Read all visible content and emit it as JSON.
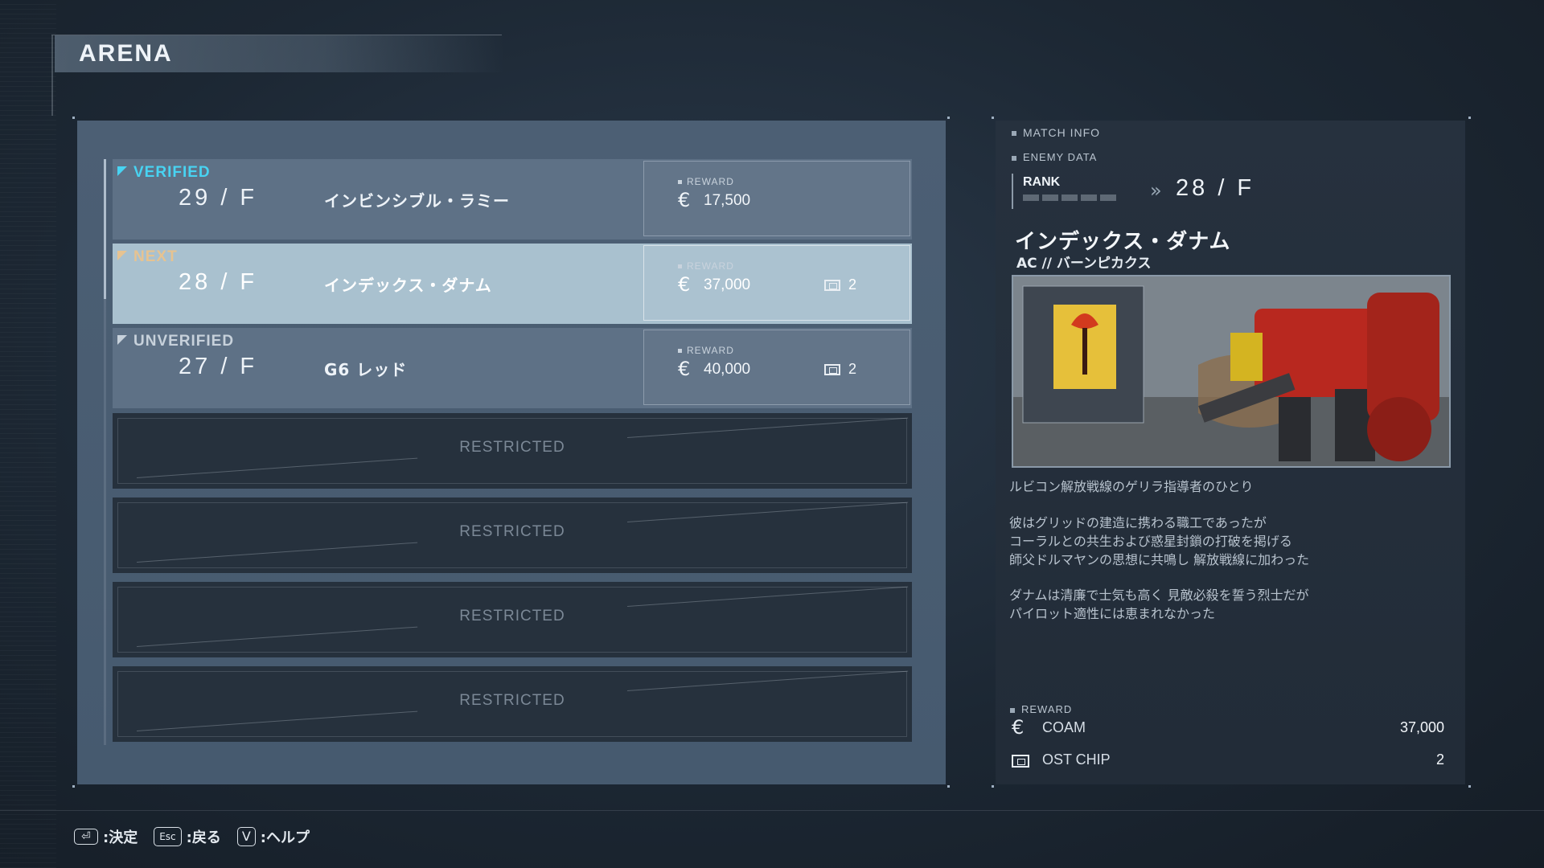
{
  "screen": {
    "title": "ARENA"
  },
  "list": {
    "rows": [
      {
        "status": "VERIFIED",
        "floor": "29 / F",
        "name": "インビンシブル・ラミー",
        "reward_label": "REWARD",
        "currency_symbol": "€",
        "reward": "17,500",
        "chips": ""
      },
      {
        "status": "NEXT",
        "floor": "28 / F",
        "name": "インデックス・ダナム",
        "reward_label": "REWARD",
        "currency_symbol": "€",
        "reward": "37,000",
        "chips": "2"
      },
      {
        "status": "UNVERIFIED",
        "floor": "27 / F",
        "name": "G6 レッド",
        "reward_label": "REWARD",
        "currency_symbol": "€",
        "reward": "40,000",
        "chips": "2"
      }
    ],
    "restricted": [
      "RESTRICTED",
      "RESTRICTED",
      "RESTRICTED",
      "RESTRICTED"
    ]
  },
  "info": {
    "match_info_label": "MATCH INFO",
    "enemy_data_label": "ENEMY DATA",
    "rank_label": "RANK",
    "rank_arrow": "»",
    "rank_value": "28 / F",
    "enemy_name": "インデックス・ダナム",
    "enemy_ac": "AC // バーンピカクス",
    "description": [
      "ルビコン解放戦線のゲリラ指導者のひとり",
      "彼はグリッドの建造に携わる職工であったが",
      "コーラルとの共生および惑星封鎖の打破を掲げる",
      "師父ドルマヤンの思想に共鳴し 解放戦線に加わった",
      "ダナムは清廉で士気も高く 見敵必殺を誓う烈士だが",
      "パイロット適性には恵まれなかった"
    ],
    "reward_label": "REWARD",
    "rewards": [
      {
        "icon": "coam-currency-icon",
        "symbol": "€",
        "name": "COAM",
        "value": "37,000"
      },
      {
        "icon": "ost-chip-icon",
        "name": "OST CHIP",
        "value": "2"
      }
    ]
  },
  "footer": {
    "confirm_key": "⏎",
    "confirm_label": ":決定",
    "back_key": "Esc",
    "back_label": ":戻る",
    "help_key": "V",
    "help_label": ":ヘルプ"
  },
  "colors": {
    "verified": "#48d3f2",
    "next": "#e6c391",
    "unverified": "#c7d1db",
    "selected_row": "#a9c1cf"
  }
}
